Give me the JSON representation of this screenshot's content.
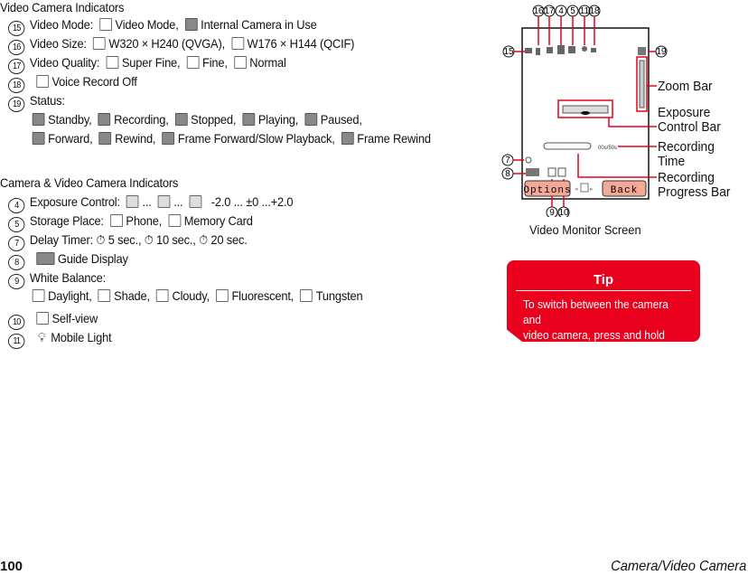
{
  "video_section": {
    "title": "Video Camera Indicators",
    "items": [
      {
        "num": "15",
        "label": "Video Mode:",
        "opts": [
          "Video Mode,",
          "Internal Camera in Use"
        ]
      },
      {
        "num": "16",
        "label": "Video Size:",
        "opts": [
          "W320 × H240 (QVGA),",
          "W176 × H144 (QCIF)"
        ]
      },
      {
        "num": "17",
        "label": "Video Quality:",
        "opts": [
          "Super Fine,",
          "Fine,",
          "Normal"
        ]
      },
      {
        "num": "18",
        "label": "",
        "opts": [
          "Voice Record Off"
        ]
      },
      {
        "num": "19",
        "label": "Status:",
        "opts": [
          "Standby,",
          "Recording,",
          "Stopped,",
          "Playing,",
          "Paused,",
          "Forward,",
          "Rewind,",
          "Frame Forward/Slow Playback,",
          "Frame Rewind"
        ]
      }
    ]
  },
  "camera_section": {
    "title": "Camera & Video Camera Indicators",
    "items": [
      {
        "num": "4",
        "label": "Exposure Control:",
        "opts": [
          "...",
          "...",
          "-2.0 ... ±0 ...+2.0"
        ]
      },
      {
        "num": "5",
        "label": "Storage Place:",
        "opts": [
          "Phone,",
          "Memory Card"
        ]
      },
      {
        "num": "7",
        "label": "Delay Timer:",
        "opts": [
          "5 sec.,",
          "10 sec.,",
          "20 sec."
        ]
      },
      {
        "num": "8",
        "label": "",
        "opts": [
          "Guide Display"
        ]
      },
      {
        "num": "9",
        "label": "White Balance:",
        "opts": [
          "Daylight,",
          "Shade,",
          "Cloudy,",
          "Fluorescent,",
          "Tungsten"
        ]
      },
      {
        "num": "10",
        "label": "",
        "opts": [
          "Self-view"
        ]
      },
      {
        "num": "11",
        "label": "",
        "opts": [
          "Mobile Light"
        ]
      }
    ]
  },
  "diagram": {
    "caption": "Video Monitor Screen",
    "top_callouts": [
      "16",
      "17",
      "4",
      "5",
      "11",
      "18"
    ],
    "left_callouts": [
      "15",
      "7",
      "8"
    ],
    "bottom_callouts": [
      "9",
      "10"
    ],
    "right_callout": "19",
    "labels": {
      "zoom_bar": "Zoom Bar",
      "exposure": [
        "Exposure",
        "Control Bar"
      ],
      "rec_time": [
        "Recording",
        "Time"
      ],
      "rec_progress": [
        "Recording",
        "Progress Bar"
      ]
    },
    "screen": {
      "time_text": "00s/50s",
      "options_button": "Options",
      "back_button": "Back"
    },
    "accent": "#e8001c",
    "softkey_color": "#f4a898"
  },
  "tip": {
    "title": "Tip",
    "text_line1": "To switch between the camera and",
    "text_line2": "video camera, press and hold",
    "key": "◘/▲",
    "end": "."
  },
  "footer": {
    "page_number": "100",
    "section": "Camera/Video Camera"
  }
}
